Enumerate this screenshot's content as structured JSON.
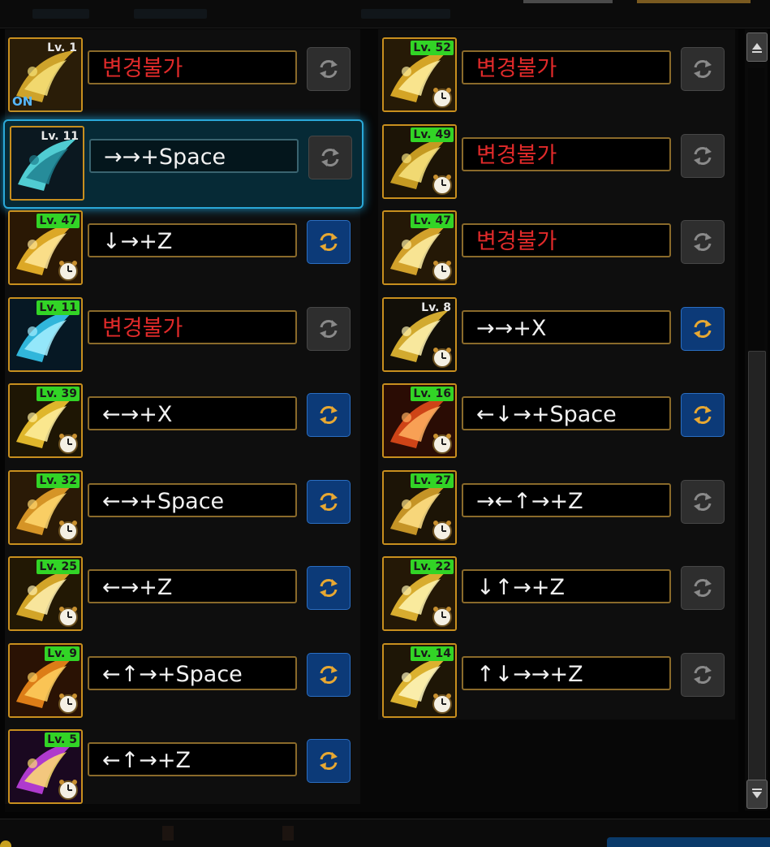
{
  "colors": {
    "unchangeable_text": "#e02a2a",
    "command_text": "#f2f2f2",
    "level_badge_bg": "#32d426",
    "active_border": "#2aa8d8",
    "button_enabled": "#0c3a78",
    "button_disabled": "#2e2e2e"
  },
  "left_column": [
    {
      "level": "Lv. 1",
      "on_label": "ON",
      "command": "변경불가",
      "locked": true,
      "button": "disabled",
      "icon": "flow-character-icon",
      "cooldown": false,
      "active": false
    },
    {
      "level": "Lv. 11",
      "command": "→→+Space",
      "locked": false,
      "button": "disabled",
      "icon": "pillar-strike-icon",
      "cooldown": false,
      "active": true
    },
    {
      "level": "Lv. 47",
      "command": "↓→+Z",
      "locked": false,
      "button": "enabled",
      "icon": "golden-swirl-icon",
      "cooldown": true,
      "active": false
    },
    {
      "level": "Lv. 11",
      "command": "변경불가",
      "locked": true,
      "button": "disabled",
      "icon": "ice-flow-icon",
      "cooldown": false,
      "active": false
    },
    {
      "level": "Lv. 39",
      "command": "←→+X",
      "locked": false,
      "button": "enabled",
      "icon": "crescent-slash-icon",
      "cooldown": true,
      "active": false
    },
    {
      "level": "Lv. 32",
      "command": "←→+Space",
      "locked": false,
      "button": "enabled",
      "icon": "sword-burst-icon",
      "cooldown": true,
      "active": false
    },
    {
      "level": "Lv. 25",
      "command": "←→+Z",
      "locked": false,
      "button": "enabled",
      "icon": "arc-slash-icon",
      "cooldown": true,
      "active": false
    },
    {
      "level": "Lv. 9",
      "command": "←↑→+Space",
      "locked": false,
      "button": "enabled",
      "icon": "flame-fan-icon",
      "cooldown": true,
      "active": false
    },
    {
      "level": "Lv. 5",
      "command": "←↑→+Z",
      "locked": false,
      "button": "enabled",
      "icon": "purple-blast-icon",
      "cooldown": true,
      "active": false
    }
  ],
  "right_column": [
    {
      "level": "Lv. 52",
      "command": "변경불가",
      "locked": true,
      "button": "disabled",
      "icon": "flow-wave-icon",
      "cooldown": true,
      "active": false
    },
    {
      "level": "Lv. 49",
      "command": "변경불가",
      "locked": true,
      "button": "disabled",
      "icon": "flow-crescent-icon",
      "cooldown": true,
      "active": false
    },
    {
      "level": "Lv. 47",
      "command": "변경불가",
      "locked": true,
      "button": "disabled",
      "icon": "lightning-slash-icon",
      "cooldown": true,
      "active": false
    },
    {
      "level": "Lv. 8",
      "command": "→→+X",
      "locked": false,
      "button": "enabled",
      "icon": "star-crescent-icon",
      "cooldown": true,
      "active": false
    },
    {
      "level": "Lv. 16",
      "command": "←↓→+Space",
      "locked": false,
      "button": "enabled",
      "icon": "fire-demon-icon",
      "cooldown": true,
      "active": false
    },
    {
      "level": "Lv. 27",
      "command": "→←↑→+Z",
      "locked": false,
      "button": "disabled",
      "icon": "spiral-star-icon",
      "cooldown": true,
      "active": false
    },
    {
      "level": "Lv. 22",
      "command": "↓↑→+Z",
      "locked": false,
      "button": "disabled",
      "icon": "blade-cross-icon",
      "cooldown": true,
      "active": false
    },
    {
      "level": "Lv. 14",
      "command": "↑↓→→+Z",
      "locked": false,
      "button": "disabled",
      "icon": "spark-burst-icon",
      "cooldown": true,
      "active": false
    }
  ]
}
